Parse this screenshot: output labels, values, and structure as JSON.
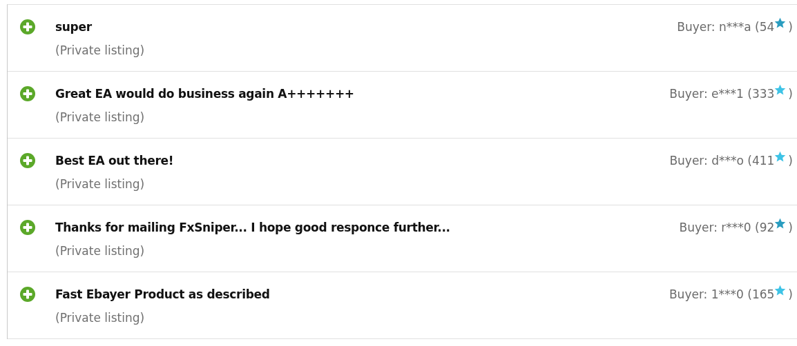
{
  "feedback": [
    {
      "kind": "positive",
      "comment": "super",
      "item": "(Private listing)",
      "buyer": "Buyer: n***a (54",
      "color": "#2a9dc0",
      "close": ")"
    },
    {
      "kind": "positive",
      "comment": "Great EA would do business again A+++++++",
      "item": "(Private listing)",
      "buyer": "Buyer: e***1 (333",
      "color": "#3ec3e6",
      "close": ")"
    },
    {
      "kind": "positive",
      "comment": "Best EA out there!",
      "item": "(Private listing)",
      "buyer": "Buyer: d***o (411",
      "color": "#3ec3e6",
      "close": ")"
    },
    {
      "kind": "positive",
      "comment": "Thanks for mailing FxSniper... I hope good responce further...",
      "item": "(Private listing)",
      "buyer": "Buyer: r***0 (92",
      "color": "#2a9dc0",
      "close": ")"
    },
    {
      "kind": "positive",
      "comment": "Fast Ebayer Product as described",
      "item": "(Private listing)",
      "buyer": "Buyer: 1***0 (165",
      "color": "#3ec3e6",
      "close": ")"
    }
  ]
}
